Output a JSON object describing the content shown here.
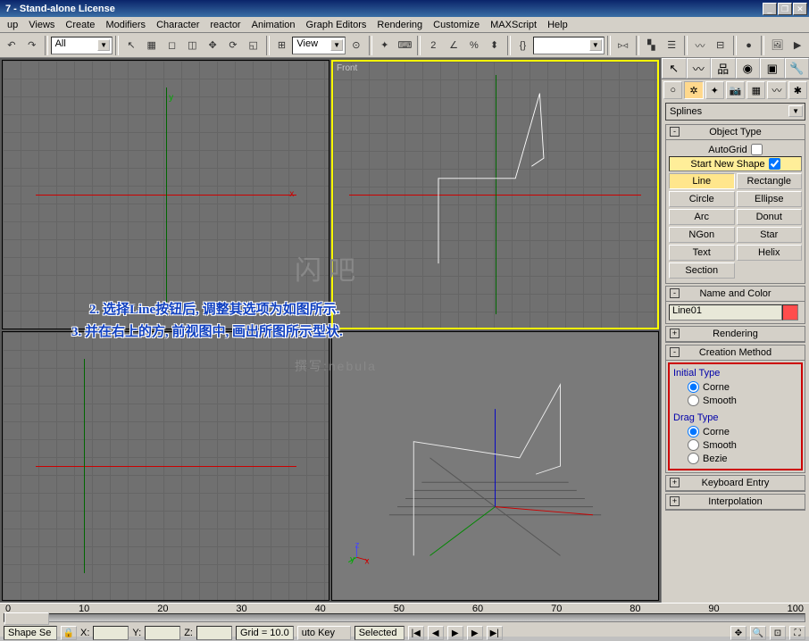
{
  "window": {
    "title": "7 - Stand-alone License"
  },
  "menu": [
    "up",
    "Views",
    "Create",
    "Modifiers",
    "Character",
    "reactor",
    "Animation",
    "Graph Editors",
    "Rendering",
    "Customize",
    "MAXScript",
    "Help"
  ],
  "toolbar": {
    "selset": "All",
    "viewlabel": "View"
  },
  "viewports": {
    "front_label": "Front",
    "axis_x": "x",
    "axis_y": "y",
    "axis_z": "z"
  },
  "cmdpanel": {
    "category": "Splines",
    "object_type": {
      "title": "Object Type",
      "autogrid": "AutoGrid",
      "startnew": "Start New Shape",
      "buttons": [
        [
          "Line",
          "Rectangle"
        ],
        [
          "Circle",
          "Ellipse"
        ],
        [
          "Arc",
          "Donut"
        ],
        [
          "NGon",
          "Star"
        ],
        [
          "Text",
          "Helix"
        ],
        [
          "Section",
          ""
        ]
      ]
    },
    "name_color": {
      "title": "Name and Color",
      "value": "Line01",
      "color": "#ff4d4d"
    },
    "rendering": {
      "title": "Rendering"
    },
    "creation": {
      "title": "Creation Method",
      "initial_label": "Initial Type",
      "drag_label": "Drag Type",
      "opts_initial": [
        "Corne",
        "Smooth"
      ],
      "opts_drag": [
        "Corne",
        "Smooth",
        "Bezie"
      ]
    },
    "keyboard": {
      "title": "Keyboard Entry"
    },
    "interp": {
      "title": "Interpolation"
    }
  },
  "timeline": {
    "ticks": [
      "0",
      "10",
      "20",
      "30",
      "40",
      "50",
      "60",
      "70",
      "80",
      "90",
      "100"
    ]
  },
  "status": {
    "shape": "Shape Se",
    "x": "X:",
    "y": "Y:",
    "z": "Z:",
    "grid": "Grid = 10.0",
    "autokey": "uto Key",
    "selected": "Selected"
  },
  "annotations": {
    "line1": "2. 选择Line按钮后, 调整其选项为如图所示.",
    "line2": "3. 并在右上的方, 前视图中, 画出所图所示型状.",
    "wm1": "闪吧",
    "wm2": "撰写:nebula"
  }
}
